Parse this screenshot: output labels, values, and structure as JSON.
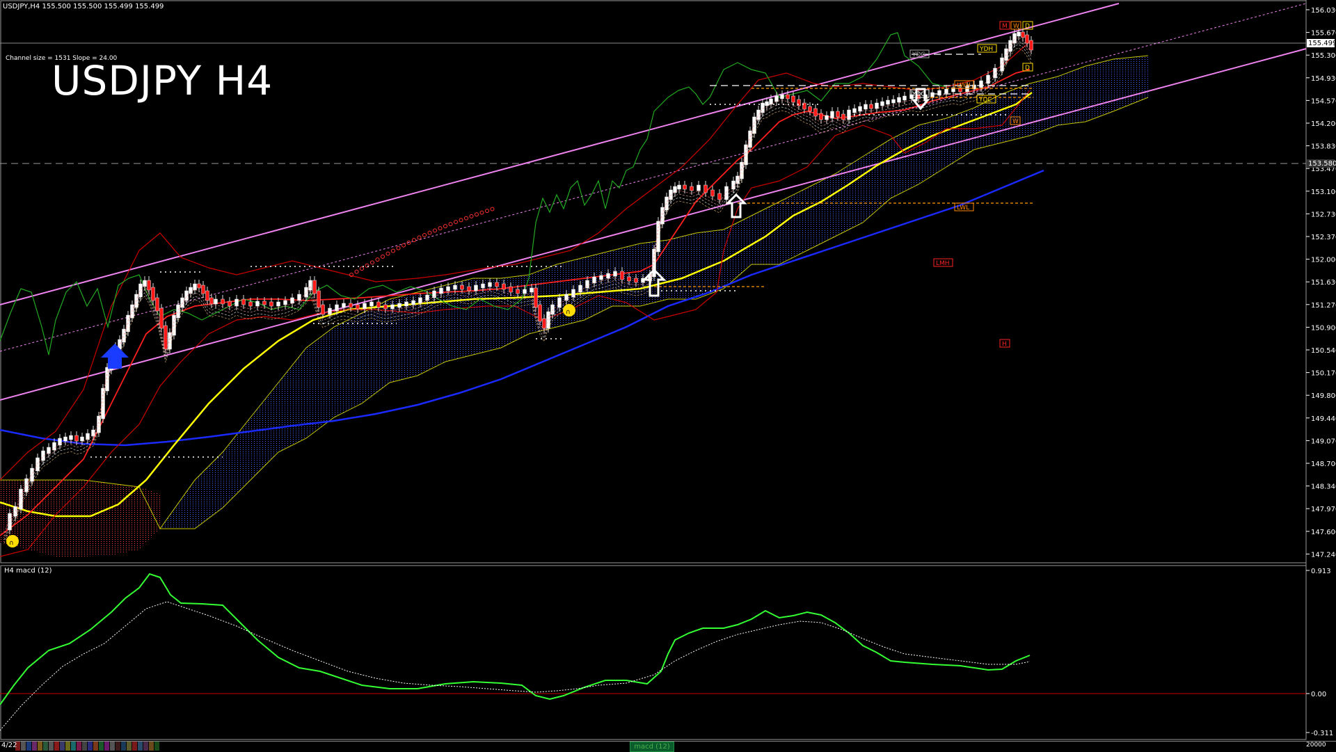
{
  "header": {
    "symbol_info": "USDJPY,H4  155.500 155.500 155.499 155.499",
    "channel_info": "Channel size = 1531 Slope = 24.00",
    "title": "USDJPY H4"
  },
  "price_axis": {
    "ticks": [
      "156.030",
      "155.670",
      "155.300",
      "154.930",
      "154.570",
      "154.200",
      "153.830",
      "153.470",
      "153.100",
      "152.730",
      "152.370",
      "152.000",
      "151.630",
      "151.270",
      "150.900",
      "150.540",
      "150.170",
      "149.800",
      "149.440",
      "149.070",
      "148.700",
      "148.340",
      "147.970",
      "147.600",
      "147.240"
    ],
    "current_price": "155.499",
    "marked_level": "153.580"
  },
  "macd_panel": {
    "label": "H4  macd (12)",
    "ticks": [
      "0.913",
      "0.00",
      "-0.311"
    ],
    "tab_label": "macd (12)"
  },
  "level_tags": [
    "YDC",
    "YDH",
    "YDO",
    "LWH",
    "YDL",
    "M",
    "W",
    "D",
    "D",
    "W",
    "LWL",
    "LMH",
    "H"
  ],
  "footer": {
    "date_label": "4/22",
    "right_label": "20000"
  },
  "colors": {
    "background": "#000000",
    "channel": "#ee82ee",
    "ma_yellow": "#ffff00",
    "ma_blue": "#1a2aff",
    "bands": "#cc0000",
    "macd": "#33ff33",
    "signal": "#ffffff",
    "cloud": "#1e3cff",
    "cloud_red": "#ff3030"
  }
}
